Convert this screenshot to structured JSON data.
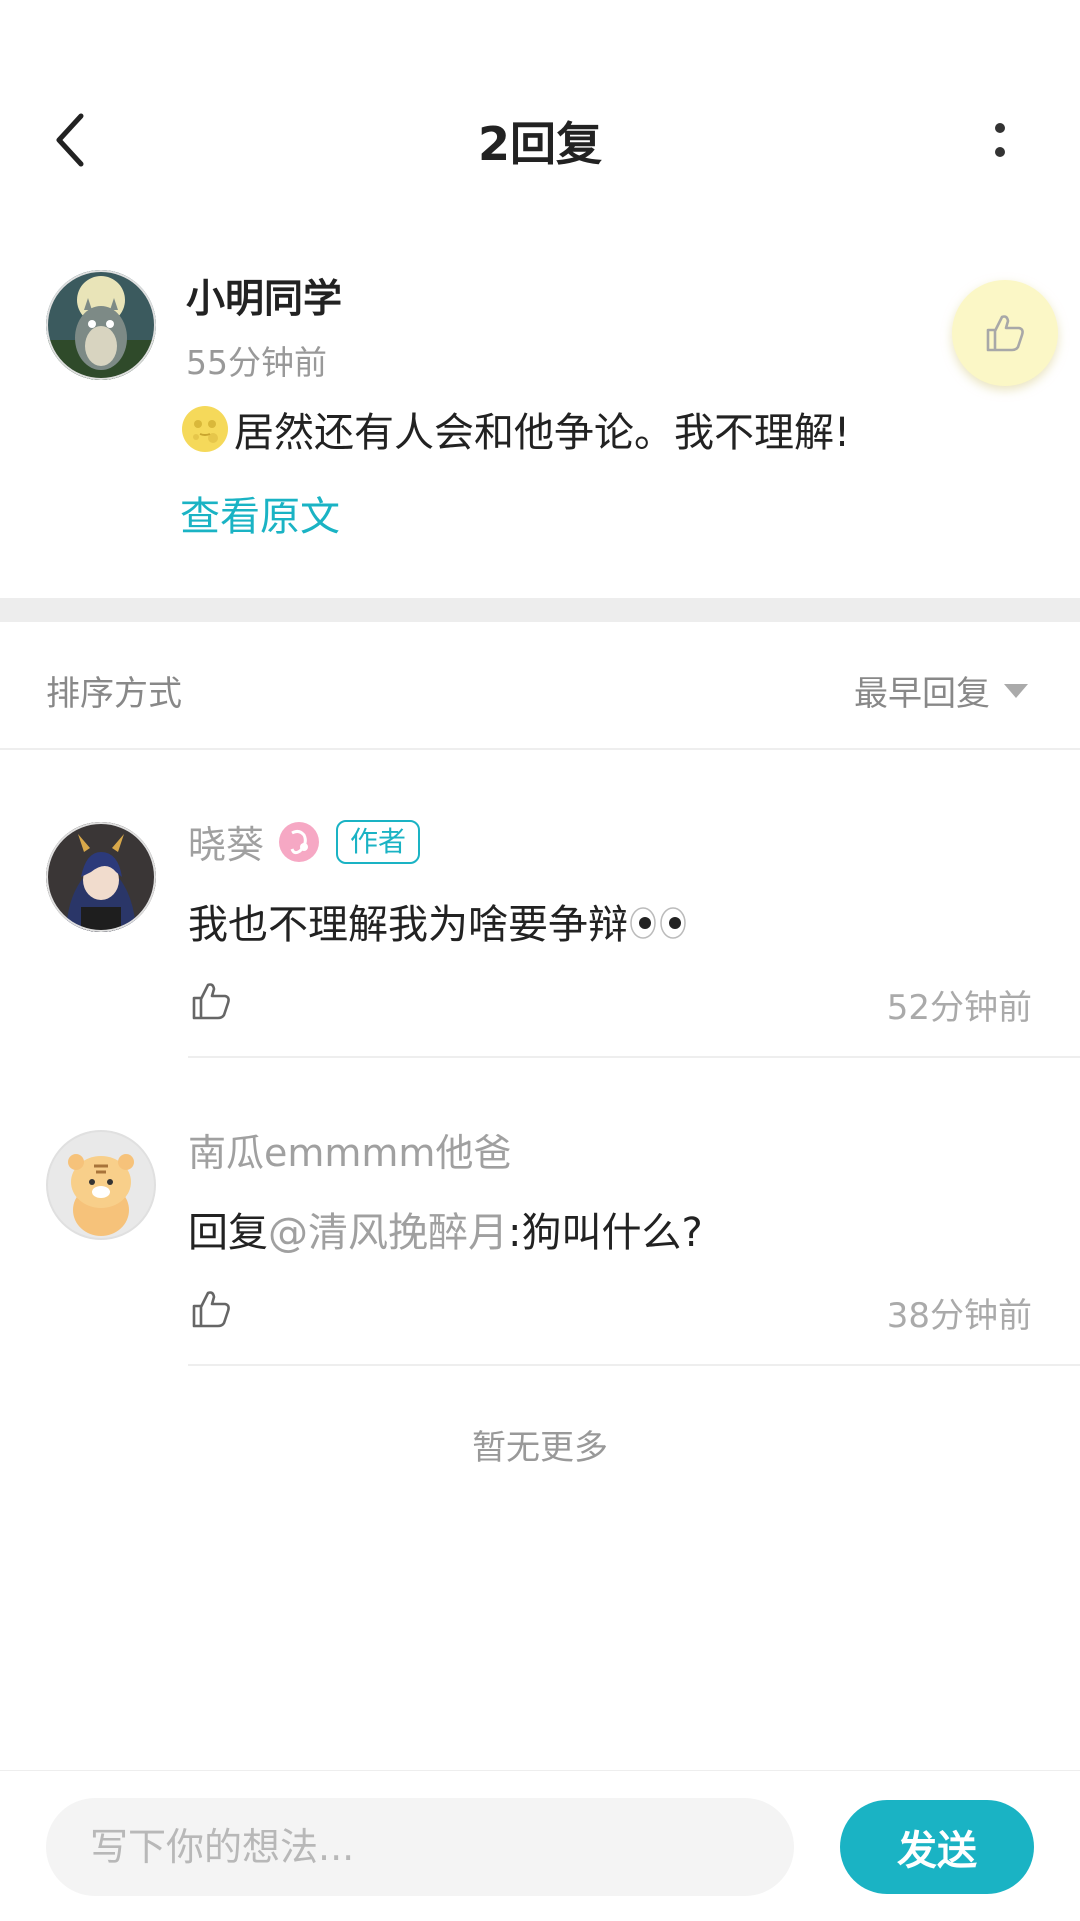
{
  "header": {
    "title": "2回复"
  },
  "main_comment": {
    "author": "小明同学",
    "time": "55分钟前",
    "text": "居然还有人会和他争论。我不理解!",
    "view_original": "查看原文"
  },
  "sort": {
    "label": "排序方式",
    "selected": "最早回复"
  },
  "replies": [
    {
      "author": "晓葵",
      "badge": "作者",
      "text": "我也不理解我为啥要争辩",
      "time": "52分钟前"
    },
    {
      "author": "南瓜emmmm他爸",
      "reply_prefix": "回复",
      "mention": "@清风挽醉月",
      "text": ":狗叫什么?",
      "time": "38分钟前"
    }
  ],
  "footer_note": "暂无更多",
  "input": {
    "placeholder": "写下你的想法...",
    "send_label": "发送"
  },
  "colors": {
    "accent": "#1ab3c4",
    "like_highlight": "#fbf7c6"
  }
}
